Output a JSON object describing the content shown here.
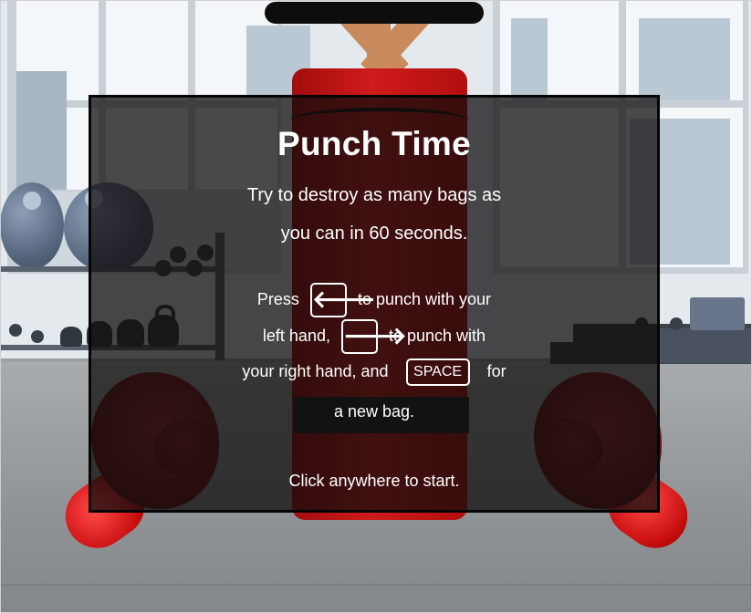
{
  "game": {
    "title": "Punch Time",
    "intro_line_1": "Try to destroy as many bags as",
    "intro_line_2": "you can in 60 seconds.",
    "instructions": {
      "press": "Press",
      "left_key_icon": "left-arrow-icon",
      "left_key_glyph": "🡐",
      "left_text": "to punch with your",
      "left_hand": "left hand,",
      "right_key_icon": "right-arrow-icon",
      "right_key_glyph": "🡒",
      "right_text": "to punch with",
      "right_hand": "your right hand, and",
      "space_key": "SPACE",
      "space_text": "for",
      "new_bag": "a new bag."
    },
    "start_prompt": "Click anywhere to start."
  },
  "colors": {
    "bag": "#c41515",
    "glove": "#6d1114",
    "overlay": "#0f0c0c"
  }
}
